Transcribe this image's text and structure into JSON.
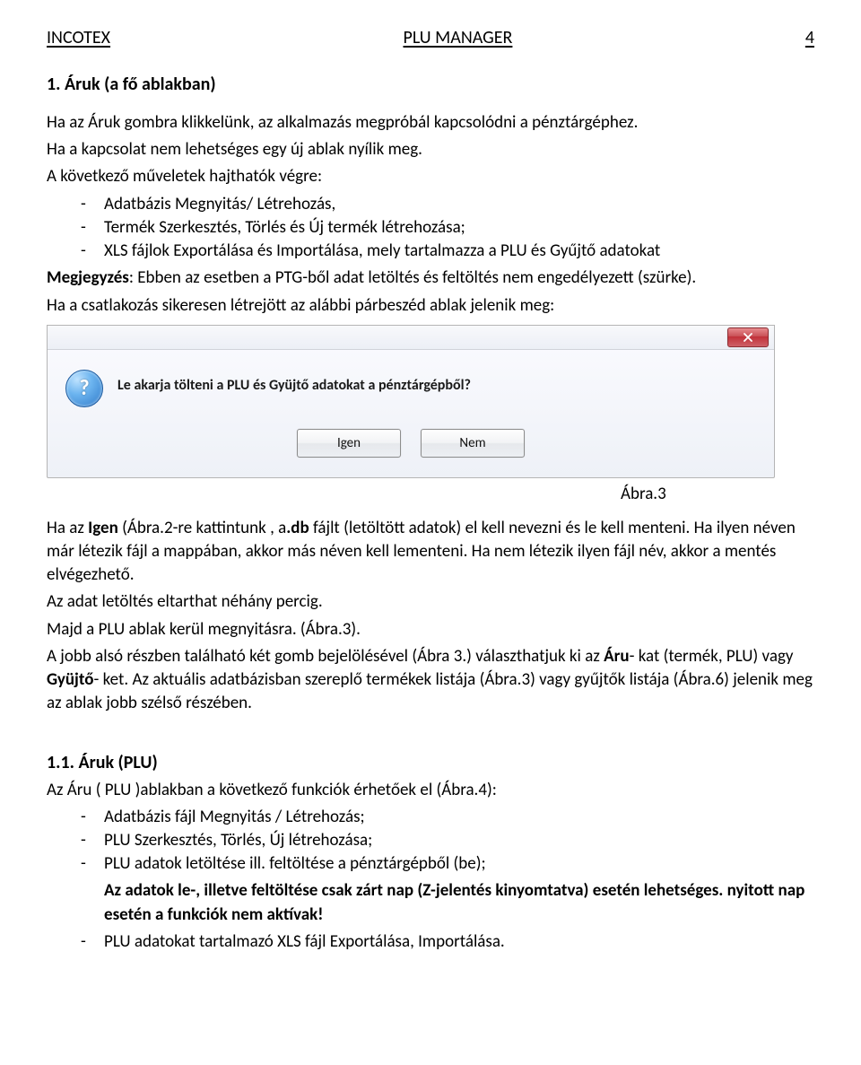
{
  "header": {
    "left": "INCOTEX",
    "center": "PLU MANAGER",
    "page_number": "4"
  },
  "section1": {
    "number_title": "1.   Áruk (a fő ablakban)",
    "para1": "Ha az Áruk gombra klikkelünk, az alkalmazás megpróbál kapcsolódni a pénztárgéphez.",
    "para2": "Ha a kapcsolat nem lehetséges egy új ablak nyílik meg.",
    "para3": "A következő műveletek hajthatók végre:",
    "bullets": [
      "Adatbázis Megnyitás/ Létrehozás,",
      "Termék Szerkesztés, Törlés és Új termék létrehozása;",
      "XLS fájlok Exportálása és Importálása, mely tartalmazza a PLU és Gyűjtő adatokat"
    ],
    "note_label": "Megjegyzés",
    "note_rest": ": Ebben az esetben a PTG-ből adat letöltés és feltöltés nem engedélyezett (szürke).",
    "para4": "Ha a csatlakozás sikeresen létrejött az alábbi párbeszéd ablak jelenik meg:"
  },
  "dialog": {
    "message": "Le akarja tölteni a PLU és Gyüjtő adatokat a pénztárgépből?",
    "yes": "Igen",
    "no": "Nem",
    "icon": "question-icon"
  },
  "fig3_caption": "Ábra.3",
  "after_dialog": {
    "p1_a": "Ha az  ",
    "p1_b": "Igen",
    "p1_c": " (Ábra.2-re kattintunk , a",
    "p1_d": ".db",
    "p1_e": " fájlt (letöltött adatok) el kell nevezni és le kell  menteni. Ha ilyen néven már létezik fájl a mappában, akkor más néven kell lementeni. Ha nem létezik ilyen fájl név, akkor a mentés elvégezhető.",
    "p2": "Az adat letöltés eltarthat néhány percig.",
    "p3": "Majd a PLU ablak kerül megnyitásra. (Ábra.3).",
    "p4_a": "A jobb alsó részben található két gomb bejelölésével (Ábra 3.) választhatjuk ki az  ",
    "p4_b": "Áru",
    "p4_c": "- kat (termék, PLU) vagy ",
    "p4_d": "Gyüjtő",
    "p4_e": "- ket. Az aktuális adatbázisban szereplő termékek listája  (Ábra.3) vagy gyűjtők listája (Ábra.6) jelenik meg az ablak jobb szélső részében."
  },
  "section11": {
    "title": "1.1.    Áruk (PLU)",
    "intro": "Az Áru ( PLU )ablakban a következő funkciók érhetőek el (Ábra.4):",
    "bullets_plain": [
      "Adatbázis fájl Megnyitás / Létrehozás;",
      "PLU Szerkesztés, Törlés, Új létrehozása;",
      "PLU adatok letöltése ill.  feltöltése a pénztárgépből (be);"
    ],
    "bold_line1": "Az adatok le-, illetve feltöltése csak zárt nap (Z-jelentés kinyomtatva) esetén lehetséges. nyitott nap esetén a funkciók nem aktívak!",
    "bullets_plain2": [
      "PLU adatokat tartalmazó XLS fájl Exportálása, Importálása."
    ]
  }
}
